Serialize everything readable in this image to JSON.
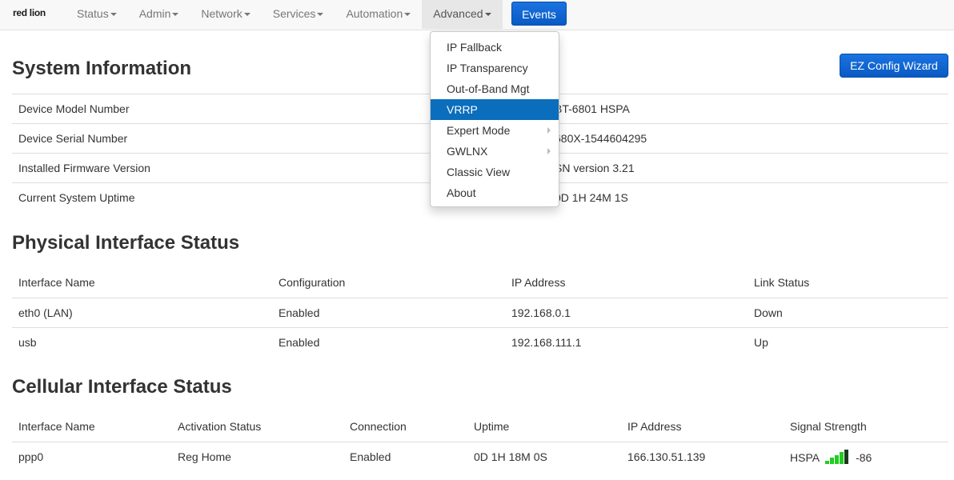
{
  "nav": {
    "brand": "red lion",
    "items": [
      {
        "label": "Status"
      },
      {
        "label": "Admin"
      },
      {
        "label": "Network"
      },
      {
        "label": "Services"
      },
      {
        "label": "Automation"
      },
      {
        "label": "Advanced"
      }
    ],
    "events_label": "Events"
  },
  "dropdown": {
    "items": [
      {
        "label": "IP Fallback"
      },
      {
        "label": "IP Transparency"
      },
      {
        "label": "Out-of-Band Mgt"
      },
      {
        "label": "VRRP"
      },
      {
        "label": "Expert Mode"
      },
      {
        "label": "GWLNX"
      },
      {
        "label": "Classic View"
      },
      {
        "label": "About"
      }
    ]
  },
  "system_info": {
    "title": "System Information",
    "wizard_label": "EZ Config Wizard",
    "rows": [
      {
        "label": "Device Model Number",
        "value": "BT-6801 HSPA"
      },
      {
        "label": "Device Serial Number",
        "value": "680X-1544604295"
      },
      {
        "label": "Installed Firmware Version",
        "value": "SN version 3.21"
      },
      {
        "label": "Current System Uptime",
        "value": "0D 1H 24M 1S"
      }
    ]
  },
  "physical": {
    "title": "Physical Interface Status",
    "headers": [
      "Interface Name",
      "Configuration",
      "IP Address",
      "Link Status"
    ],
    "rows": [
      [
        "eth0 (LAN)",
        "Enabled",
        "192.168.0.1",
        "Down"
      ],
      [
        "usb",
        "Enabled",
        "192.168.111.1",
        "Up"
      ]
    ]
  },
  "cellular": {
    "title": "Cellular Interface Status",
    "headers": [
      "Interface Name",
      "Activation Status",
      "Connection",
      "Uptime",
      "IP Address",
      "Signal Strength"
    ],
    "rows": [
      {
        "name": "ppp0",
        "activation": "Reg Home",
        "connection": "Enabled",
        "uptime": "0D 1H 18M 0S",
        "ip": "166.130.51.139",
        "tech": "HSPA",
        "signal_bars": 4,
        "signal_max": 5,
        "rssi": "-86"
      }
    ]
  },
  "colors": {
    "accent": "#0a6ebd",
    "signal_on": "#22cc22",
    "signal_off": "#1a3a1a"
  }
}
